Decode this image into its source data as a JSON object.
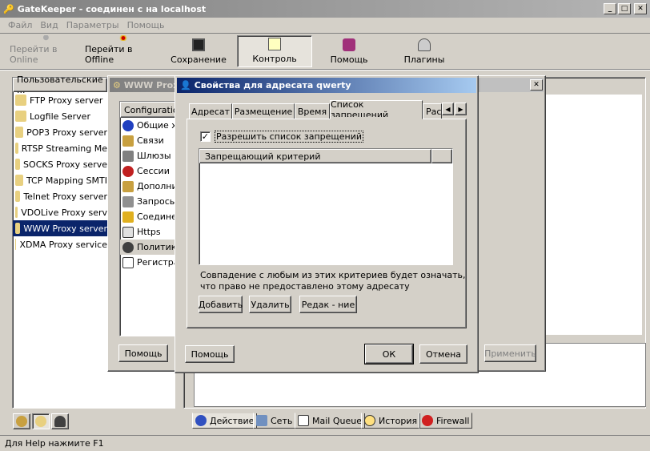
{
  "app": {
    "title": "GateKeeper - соединен с на localhost"
  },
  "window_controls": {
    "min": "_",
    "max": "□",
    "close": "✕"
  },
  "menu": [
    "Файл",
    "Вид",
    "Параметры",
    "Помощь"
  ],
  "toolbar": {
    "online": "Перейти в Online",
    "offline": "Перейти в Offline",
    "save": "Сохранение",
    "control": "Контроль",
    "help": "Помощь",
    "plugins": "Плагины"
  },
  "left_panel": {
    "header": "Пользовательские ...",
    "items": [
      "FTP Proxy server",
      "Logfile Server",
      "POP3 Proxy server",
      "RTSP Streaming Me",
      "SOCKS Proxy serve",
      "TCP Mapping SMTI",
      "Telnet Proxy server",
      "VDOLive Proxy serv",
      "WWW Proxy server",
      "XDMA Proxy service"
    ],
    "selected": "WWW Proxy server"
  },
  "proxy_window": {
    "title": "WWW Prox",
    "config_header": "Configuration",
    "nav": [
      "Общие х",
      "Связи",
      "Шлюзы",
      "Сессии",
      "Дополни",
      "Запросы",
      "Соедине",
      "Https",
      "Политик",
      "Регистра"
    ],
    "help_button": "Помощь",
    "apply_button": "Применить"
  },
  "dialog": {
    "title": "Свойства для адресата qwerty",
    "tabs": [
      "Адресат",
      "Размещение",
      "Время",
      "Список запрещений",
      "Рас"
    ],
    "active_tab": "Список запрещений",
    "checkbox_label": "Разрешить список запрещений",
    "checkbox_checked": true,
    "column_header": "Запрещающий критерий",
    "info_line1": "Совпадение с любым из этих критериев будет означать,",
    "info_line2": "что право не предоставлено этому адресату",
    "add": "Добавить",
    "delete": "Удалить",
    "edit": "Редак - ние",
    "help": "Помощь",
    "ok": "ОК",
    "cancel": "Отмена"
  },
  "bottom_tabs": [
    "Действие",
    "Сеть",
    "Mail Queue",
    "История",
    "Firewall"
  ],
  "status_bar": "Для Help нажмите F1",
  "colors": {
    "selection": "#0a246a",
    "title_active": "#0a246a",
    "face": "#d4d0c8"
  }
}
